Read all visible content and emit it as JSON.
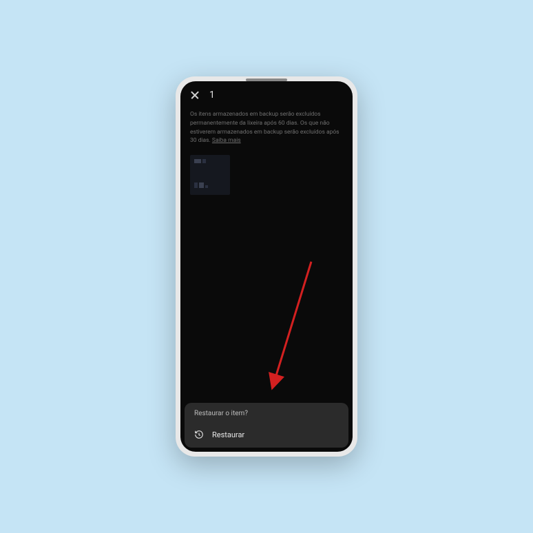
{
  "header": {
    "selection_count": "1"
  },
  "info": {
    "text": "Os itens armazenados em backup serão excluídos permanentemente da lixeira após 60 dias. Os que não estiverem armazenados em backup serão excluídos após 30 dias. ",
    "link_label": "Saiba mais"
  },
  "sheet": {
    "title": "Restaurar o item?",
    "restore_label": "Restaurar"
  }
}
